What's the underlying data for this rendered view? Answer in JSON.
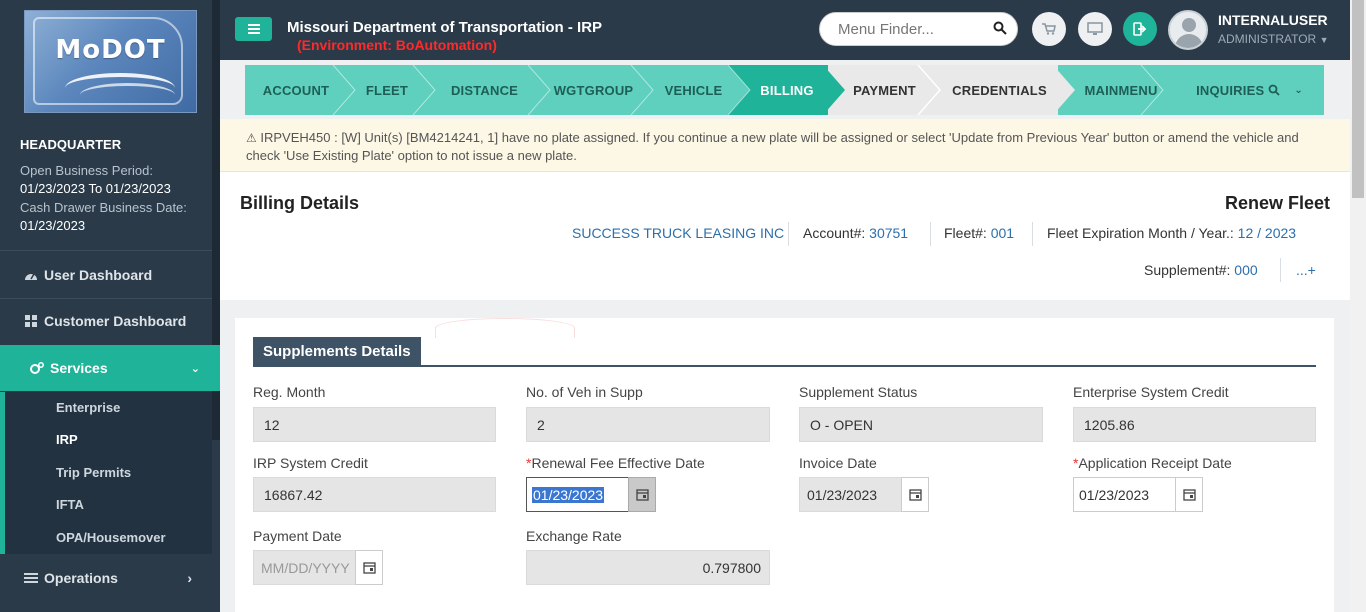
{
  "app": {
    "title": "Missouri Department of Transportation - IRP",
    "environment": "(Environment: BoAutomation)",
    "logo_text": "MoDOT"
  },
  "sidebar": {
    "office": "HEADQUARTER",
    "open_period_label": "Open Business Period:",
    "open_period_value": "01/23/2023 To 01/23/2023",
    "cash_drawer_label": "Cash Drawer Business Date:",
    "cash_drawer_value": "01/23/2023",
    "items": [
      {
        "label": "User Dashboard",
        "icon": "dashboard-icon"
      },
      {
        "label": "Customer Dashboard",
        "icon": "grid-icon"
      },
      {
        "label": "Services",
        "icon": "gears-icon"
      },
      {
        "label": "Operations",
        "icon": "list-icon"
      }
    ],
    "submenu": [
      "Enterprise",
      "IRP",
      "Trip Permits",
      "IFTA",
      "OPA/Housemover"
    ]
  },
  "header": {
    "menu_finder_placeholder": "Menu Finder...",
    "user_name": "INTERNALUSER",
    "user_role": "ADMINISTRATOR"
  },
  "tabs": [
    "ACCOUNT",
    "FLEET",
    "DISTANCE",
    "WGTGROUP",
    "VEHICLE",
    "BILLING",
    "PAYMENT",
    "CREDENTIALS",
    "MAINMENU",
    "INQUIRIES"
  ],
  "warning": "IRPVEH450 : [W] Unit(s) [BM4214241, 1] have no plate assigned. If you continue a new plate will be assigned or select 'Update from Previous Year' button or amend the vehicle and check 'Use Existing Plate' option to not issue a new plate.",
  "billing": {
    "title": "Billing Details",
    "action": "Renew Fleet",
    "company": "SUCCESS TRUCK LEASING INC",
    "account_label": "Account#:",
    "account_value": "30751",
    "fleet_label": "Fleet#:",
    "fleet_value": "001",
    "expiration_label": "Fleet Expiration Month / Year.:",
    "expiration_value": "12 / 2023",
    "supplement_label": "Supplement#:",
    "supplement_value": "000",
    "more": "...+"
  },
  "supplements": {
    "heading": "Supplements Details",
    "reg_month_label": "Reg. Month",
    "reg_month": "12",
    "veh_count_label": "No. of Veh in Supp",
    "veh_count": "2",
    "status_label": "Supplement Status",
    "status": "O - OPEN",
    "ent_credit_label": "Enterprise System Credit",
    "ent_credit": "1205.86",
    "irp_credit_label": "IRP System Credit",
    "irp_credit": "16867.42",
    "renewal_label": "Renewal Fee Effective Date",
    "renewal_date": "01/23/2023",
    "invoice_label": "Invoice Date",
    "invoice_date": "01/23/2023",
    "app_receipt_label": "Application Receipt Date",
    "app_receipt_date": "01/23/2023",
    "payment_label": "Payment Date",
    "payment_placeholder": "MM/DD/YYYY",
    "exchange_label": "Exchange Rate",
    "exchange_rate": "0.797800",
    "required_mark": "*"
  }
}
